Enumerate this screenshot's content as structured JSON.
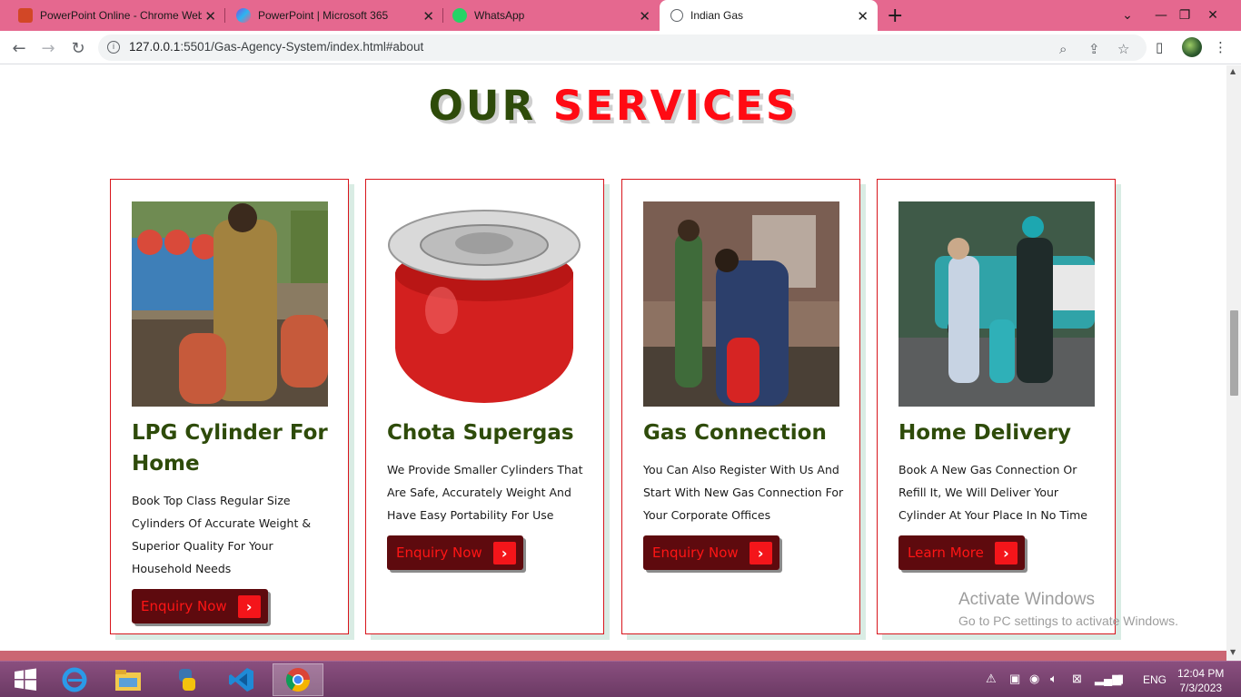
{
  "browser": {
    "tabs": [
      {
        "title": "PowerPoint Online - Chrome Web",
        "favicon_color": "#d24726"
      },
      {
        "title": "PowerPoint | Microsoft 365",
        "favicon_color": "#7b4de0"
      },
      {
        "title": "WhatsApp",
        "favicon_color": "#25d366"
      },
      {
        "title": "Indian Gas",
        "favicon_color": "#5f6368"
      }
    ],
    "url": {
      "host": "127.0.0.1",
      "rest": ":5501/Gas-Agency-System/index.html#about"
    }
  },
  "page": {
    "heading": {
      "word1": "OUR",
      "word2": "SERVICES"
    },
    "colors": {
      "heading_dark": "#2e4b0a",
      "heading_accent": "#ff0a13",
      "card_border": "#d8151c",
      "button_bg": "#5e0a0e"
    },
    "cards": [
      {
        "title": "LPG Cylinder For Home",
        "text": "Book Top Class Regular Size Cylinders Of Accurate Weight & Superior Quality For Your Household Needs",
        "button": "Enquiry Now"
      },
      {
        "title": "Chota Supergas",
        "text": "We Provide Smaller Cylinders That Are Safe, Accurately Weight And Have Easy Portability For Use",
        "button": "Enquiry Now"
      },
      {
        "title": "Gas Connection",
        "text": "You Can Also Register With Us And Start With New Gas Connection For Your Corporate Offices",
        "button": "Enquiry Now"
      },
      {
        "title": "Home Delivery",
        "text": "Book A New Gas Connection Or Refill It, We Will Deliver Your Cylinder At Your Place In No Time",
        "button": "Learn More"
      }
    ]
  },
  "watermark": {
    "line1": "Activate Windows",
    "line2": "Go to PC settings to activate Windows."
  },
  "taskbar": {
    "lang": "ENG",
    "time": "12:04 PM",
    "date": "7/3/2023"
  }
}
